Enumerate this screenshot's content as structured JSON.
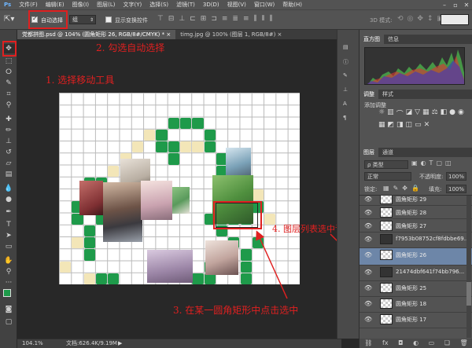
{
  "menu": {
    "items": [
      "文件(F)",
      "编辑(E)",
      "图像(I)",
      "图层(L)",
      "文字(Y)",
      "选择(S)",
      "滤镜(T)",
      "3D(D)",
      "视图(V)",
      "窗口(W)",
      "帮助(H)"
    ]
  },
  "window_controls": [
    "–",
    "▫",
    "✕"
  ],
  "options": {
    "auto_select_label": "自动选择",
    "auto_select_checked": true,
    "target_value": "组",
    "show_transform_label": "显示变换控件",
    "mode_3d_label": "3D 模式:"
  },
  "tabs": [
    {
      "label": "党都拼图.psd @ 104% (圆角矩形 26, RGB/8#/CMYK) *",
      "close": "×",
      "active": true
    },
    {
      "label": "timg.jpg @ 100% (图层 1, RGB/8#)",
      "close": "×",
      "active": false
    }
  ],
  "status": {
    "zoom": "104.1%",
    "doc": "文档:626.4K/9.19M"
  },
  "annotations": {
    "step1": "1. 选择移动工具",
    "step2": "2. 勾选自动选择",
    "step3": "3. 在某一圆角矩形中点击选中",
    "step4": "4. 图层列表选中该圆角矩形图层"
  },
  "panels": {
    "histogram_tabs": [
      "直方图",
      "信息"
    ],
    "adjust_tabs": [
      "调整",
      "样式"
    ],
    "adjust_title": "添加调整",
    "layers_tabs": [
      "图层",
      "通道"
    ],
    "filter_kind": "ρ 类型",
    "blend_mode": "正常",
    "opacity_label": "不透明度:",
    "opacity_value": "100%",
    "lock_label": "锁定:",
    "fill_label": "填充:",
    "fill_value": "100%"
  },
  "layers": [
    {
      "name": "圆角矩形 29",
      "selected": false
    },
    {
      "name": "圆角矩形 28",
      "selected": false
    },
    {
      "name": "圆角矩形 27",
      "selected": false
    },
    {
      "name": "f7953b08752cf8fdbbe69...",
      "selected": false
    },
    {
      "name": "圆角矩形 26",
      "selected": true
    },
    {
      "name": "21474dbf641f74bb796...",
      "selected": false
    },
    {
      "name": "圆角矩形 25",
      "selected": false
    },
    {
      "name": "圆角矩形 18",
      "selected": false
    },
    {
      "name": "圆角矩形 17",
      "selected": false
    }
  ],
  "layers_footer_icons": [
    "link-icon",
    "fx-icon",
    "mask-icon",
    "adjust-icon",
    "folder-icon",
    "new-layer-icon",
    "trash-icon"
  ],
  "colors": {
    "accent_red": "#e02020",
    "heart_green": "#1e9a4a",
    "selected_layer": "#6d86a8"
  }
}
